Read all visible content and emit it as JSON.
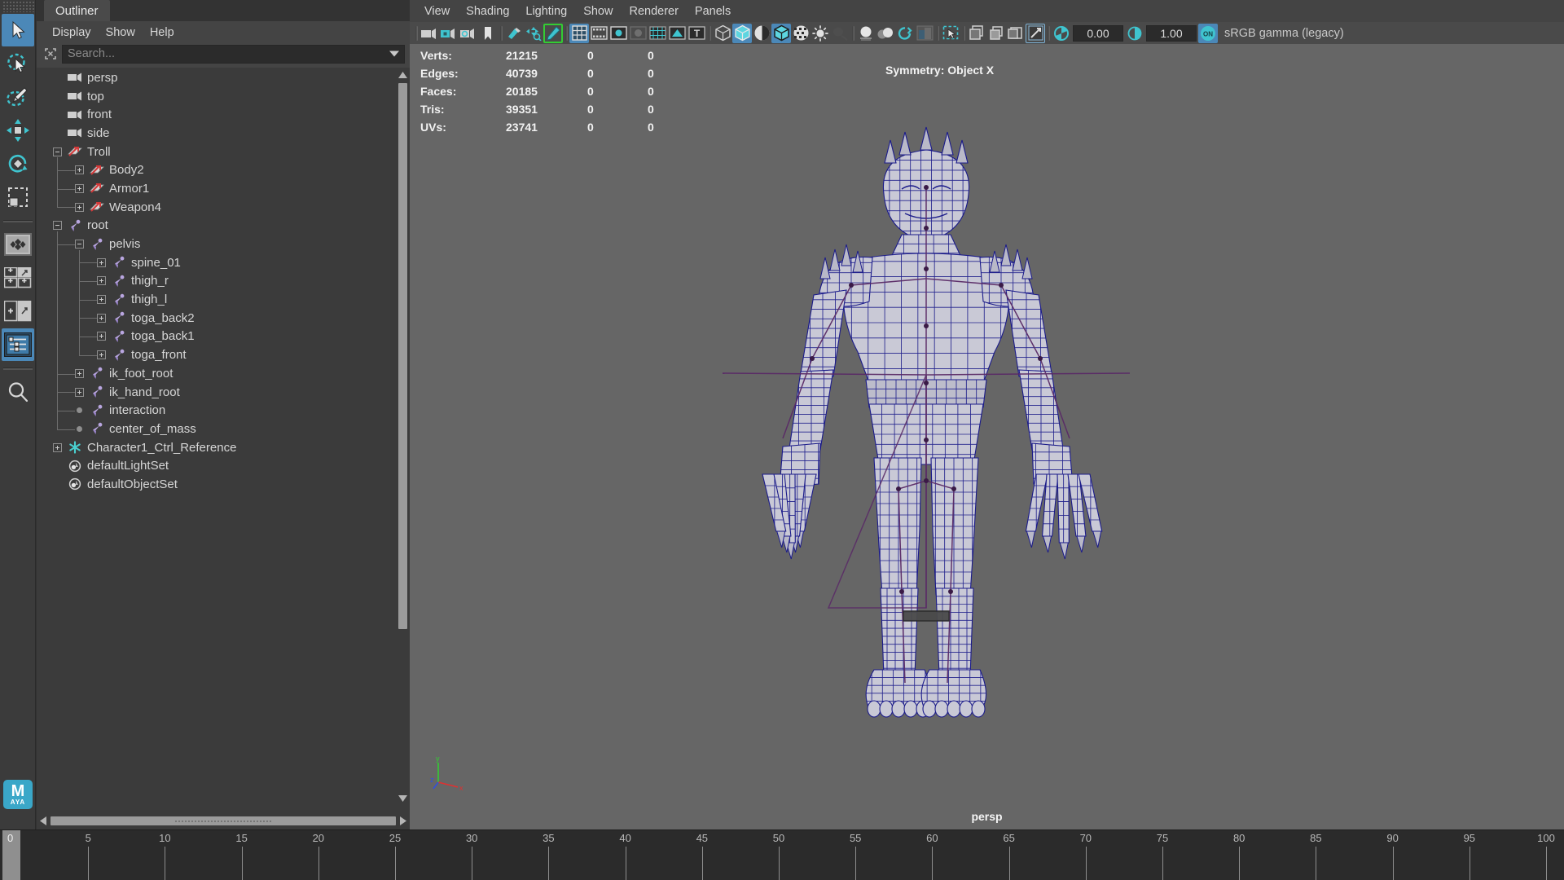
{
  "app": {
    "name": "Autodesk Maya",
    "logo_text": "M",
    "logo_sub": "AYA"
  },
  "toolbox": {
    "tools": [
      {
        "name": "select-tool",
        "label": "Select Tool",
        "selected": true
      },
      {
        "name": "lasso-select-tool",
        "label": "Lasso Select Tool",
        "selected": false
      },
      {
        "name": "paint-select-tool",
        "label": "Paint Select Tool",
        "selected": false
      },
      {
        "name": "move-tool",
        "label": "Move Tool",
        "selected": false
      },
      {
        "name": "rotate-tool",
        "label": "Rotate Tool",
        "selected": false
      },
      {
        "name": "scale-tool",
        "label": "Scale Tool",
        "selected": false
      },
      {
        "name": "last-tool",
        "label": "Last Tool Used",
        "selected": false
      },
      {
        "name": "four-view-layout",
        "label": "Four View Layout",
        "selected": false
      },
      {
        "name": "two-pane-layout",
        "label": "Two Panes Layout",
        "selected": false
      },
      {
        "name": "outliner-layout",
        "label": "Persp/Outliner Layout",
        "selected": true
      },
      {
        "name": "search-tool",
        "label": "Search",
        "selected": false
      }
    ]
  },
  "outliner": {
    "tab_label": "Outliner",
    "menus": [
      {
        "name": "display",
        "label": "Display"
      },
      {
        "name": "show",
        "label": "Show"
      },
      {
        "name": "help",
        "label": "Help"
      }
    ],
    "search": {
      "placeholder": "Search...",
      "value": ""
    },
    "items": [
      {
        "label": "persp",
        "indent": 0,
        "icon": "camera-icon",
        "expander": "none"
      },
      {
        "label": "top",
        "indent": 0,
        "icon": "camera-icon",
        "expander": "none"
      },
      {
        "label": "front",
        "indent": 0,
        "icon": "camera-icon",
        "expander": "none"
      },
      {
        "label": "side",
        "indent": 0,
        "icon": "camera-icon",
        "expander": "none"
      },
      {
        "label": "Troll",
        "indent": 0,
        "icon": "mesh-icon",
        "expander": "minus"
      },
      {
        "label": "Body2",
        "indent": 1,
        "icon": "mesh-icon",
        "expander": "plus"
      },
      {
        "label": "Armor1",
        "indent": 1,
        "icon": "mesh-icon",
        "expander": "plus"
      },
      {
        "label": "Weapon4",
        "indent": 1,
        "icon": "mesh-icon",
        "expander": "plus"
      },
      {
        "label": "root",
        "indent": 0,
        "icon": "joint-icon",
        "expander": "minus"
      },
      {
        "label": "pelvis",
        "indent": 1,
        "icon": "joint-icon",
        "expander": "minus"
      },
      {
        "label": "spine_01",
        "indent": 2,
        "icon": "joint-icon",
        "expander": "plus"
      },
      {
        "label": "thigh_r",
        "indent": 2,
        "icon": "joint-icon",
        "expander": "plus"
      },
      {
        "label": "thigh_l",
        "indent": 2,
        "icon": "joint-icon",
        "expander": "plus"
      },
      {
        "label": "toga_back2",
        "indent": 2,
        "icon": "joint-icon",
        "expander": "plus"
      },
      {
        "label": "toga_back1",
        "indent": 2,
        "icon": "joint-icon",
        "expander": "plus"
      },
      {
        "label": "toga_front",
        "indent": 2,
        "icon": "joint-icon",
        "expander": "plus"
      },
      {
        "label": "ik_foot_root",
        "indent": 1,
        "icon": "joint-icon",
        "expander": "plus"
      },
      {
        "label": "ik_hand_root",
        "indent": 1,
        "icon": "joint-icon",
        "expander": "plus"
      },
      {
        "label": "interaction",
        "indent": 1,
        "icon": "joint-icon",
        "expander": "dot"
      },
      {
        "label": "center_of_mass",
        "indent": 1,
        "icon": "joint-icon",
        "expander": "dot"
      },
      {
        "label": "Character1_Ctrl_Reference",
        "indent": 0,
        "icon": "star-icon",
        "expander": "plus"
      },
      {
        "label": "defaultLightSet",
        "indent": 0,
        "icon": "set-icon",
        "expander": "none"
      },
      {
        "label": "defaultObjectSet",
        "indent": 0,
        "icon": "set-icon",
        "expander": "none"
      }
    ]
  },
  "viewport": {
    "menus": [
      {
        "name": "view",
        "label": "View"
      },
      {
        "name": "shading",
        "label": "Shading"
      },
      {
        "name": "lighting",
        "label": "Lighting"
      },
      {
        "name": "show",
        "label": "Show"
      },
      {
        "name": "renderer",
        "label": "Renderer"
      },
      {
        "name": "panels",
        "label": "Panels"
      }
    ],
    "toolbar": {
      "exposure_value": "0.00",
      "gamma_value": "1.00",
      "color_management_toggle": "ON",
      "color_management_label": "sRGB gamma (legacy)",
      "buttons": [
        {
          "name": "select-camera-icon",
          "state": "normal"
        },
        {
          "name": "camera-attributes-icon",
          "state": "normal"
        },
        {
          "name": "lock-camera-icon",
          "state": "normal"
        },
        {
          "name": "camera-settings-icon",
          "state": "normal"
        },
        {
          "name": "bookmark-icon",
          "state": "normal"
        },
        {
          "name": "image-plane-icon",
          "state": "normal"
        },
        {
          "name": "twoD-pan-zoom-icon",
          "state": "normal"
        },
        {
          "name": "grease-pencil-icon",
          "state": "highlighted"
        },
        {
          "name": "grid-icon",
          "state": "active"
        },
        {
          "name": "film-gate-icon",
          "state": "normal"
        },
        {
          "name": "resolution-gate-icon",
          "state": "normal"
        },
        {
          "name": "gate-mask-icon",
          "state": "normal"
        },
        {
          "name": "field-chart-icon",
          "state": "normal"
        },
        {
          "name": "safe-action-icon",
          "state": "normal"
        },
        {
          "name": "safe-title-icon",
          "state": "normal"
        },
        {
          "name": "wireframe-icon",
          "state": "normal"
        },
        {
          "name": "smooth-shade-all-icon",
          "state": "active"
        },
        {
          "name": "smooth-shade-selected-icon",
          "state": "normal"
        },
        {
          "name": "shaded-wireframe-icon",
          "state": "active"
        },
        {
          "name": "textured-icon",
          "state": "normal"
        },
        {
          "name": "use-default-lighting-icon",
          "state": "normal"
        },
        {
          "name": "shadows-icon",
          "state": "normal"
        },
        {
          "name": "screen-space-ao-icon",
          "state": "normal"
        },
        {
          "name": "motion-blur-icon",
          "state": "normal"
        },
        {
          "name": "multisample-aa-icon",
          "state": "normal"
        },
        {
          "name": "depth-of-field-icon",
          "state": "normal"
        },
        {
          "name": "isolate-select-icon",
          "state": "normal"
        },
        {
          "name": "xray-icon",
          "state": "normal"
        },
        {
          "name": "xray-joints-icon",
          "state": "normal"
        },
        {
          "name": "xray-active-components-icon",
          "state": "normal"
        },
        {
          "name": "exposure-icon",
          "state": "normal"
        },
        {
          "name": "gamma-icon",
          "state": "normal"
        }
      ]
    },
    "hud": {
      "columns": [
        "",
        "",
        "",
        ""
      ],
      "rows": [
        {
          "label": "Verts:",
          "v1": "21215",
          "v2": "0",
          "v3": "0"
        },
        {
          "label": "Edges:",
          "v1": "40739",
          "v2": "0",
          "v3": "0"
        },
        {
          "label": "Faces:",
          "v1": "20185",
          "v2": "0",
          "v3": "0"
        },
        {
          "label": "Tris:",
          "v1": "39351",
          "v2": "0",
          "v3": "0"
        },
        {
          "label": "UVs:",
          "v1": "23741",
          "v2": "0",
          "v3": "0"
        }
      ]
    },
    "symmetry_label": "Symmetry: Object X",
    "camera_label": "persp",
    "axis_gizmo": {
      "x": "x",
      "y": "y",
      "z": "z"
    },
    "background_color": "#666666",
    "wireframe_color": "#1b1b8a"
  },
  "timeline": {
    "current_frame": "0",
    "ticks": [
      "0",
      "5",
      "10",
      "15",
      "20",
      "25",
      "30",
      "35",
      "40",
      "45",
      "50",
      "55",
      "60",
      "65",
      "70",
      "75",
      "80",
      "85",
      "90",
      "95",
      "100"
    ],
    "range_start": 0,
    "range_end": 100
  }
}
